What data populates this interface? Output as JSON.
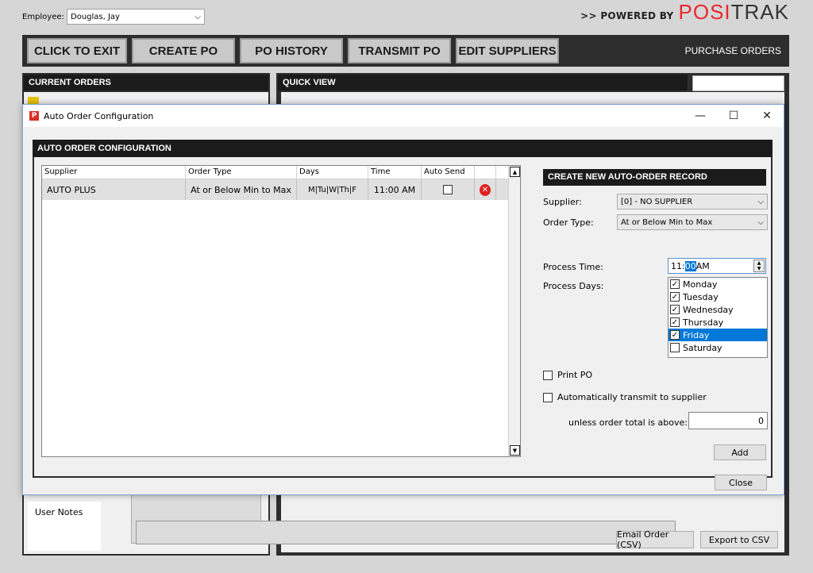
{
  "top": {
    "employee_label": "Employee:",
    "employee_value": "Douglas, Jay",
    "powered_by": ">> POWERED BY",
    "brand_part1": "POSI",
    "brand_part2": "TRAK"
  },
  "toolbar": {
    "buttons": [
      "CLICK TO EXIT",
      "CREATE PO",
      "PO HISTORY",
      "TRANSMIT PO",
      "EDIT SUPPLIERS"
    ],
    "section_title": "PURCHASE ORDERS"
  },
  "background": {
    "current_orders": "CURRENT ORDERS",
    "quick_view": "QUICK VIEW",
    "user_notes": "User Notes",
    "email_order": "Email Order (CSV)",
    "export_csv": "Export to CSV"
  },
  "dialog": {
    "title": "Auto Order Configuration",
    "logo_letter": "P",
    "minimize": "—",
    "maximize": "☐",
    "close": "✕",
    "frame_title": "AUTO ORDER CONFIGURATION",
    "grid": {
      "columns": [
        "Supplier",
        "Order Type",
        "Days",
        "Time",
        "Auto Send",
        ""
      ],
      "rows": [
        {
          "supplier": "AUTO PLUS",
          "order_type": "At or Below Min to Max",
          "days": "M|Tu|W|Th|F",
          "time": "11:00 AM",
          "auto_send": false
        }
      ]
    },
    "form": {
      "header": "CREATE NEW AUTO-ORDER RECORD",
      "supplier_label": "Supplier:",
      "supplier_value": "[0] - NO SUPPLIER",
      "order_type_label": "Order Type:",
      "order_type_value": "At or Below Min to Max",
      "process_time_label": "Process Time:",
      "time_hour": "11:",
      "time_minute": "00",
      "time_ampm": " AM",
      "process_days_label": "Process Days:",
      "days": [
        {
          "label": "Monday",
          "checked": true
        },
        {
          "label": "Tuesday",
          "checked": true
        },
        {
          "label": "Wednesday",
          "checked": true
        },
        {
          "label": "Thursday",
          "checked": true
        },
        {
          "label": "Friday",
          "checked": true
        },
        {
          "label": "Saturday",
          "checked": false
        }
      ],
      "print_po": "Print PO",
      "auto_transmit": "Automatically transmit to supplier",
      "unless_label": "unless order total is above:",
      "threshold_value": "0",
      "add_button": "Add",
      "close_button": "Close"
    }
  },
  "colors": {
    "accent_blue": "#0078d7",
    "brand_red": "#e8282e",
    "dark_panel": "#2d2d2d",
    "header_black": "#1b1b1b"
  }
}
